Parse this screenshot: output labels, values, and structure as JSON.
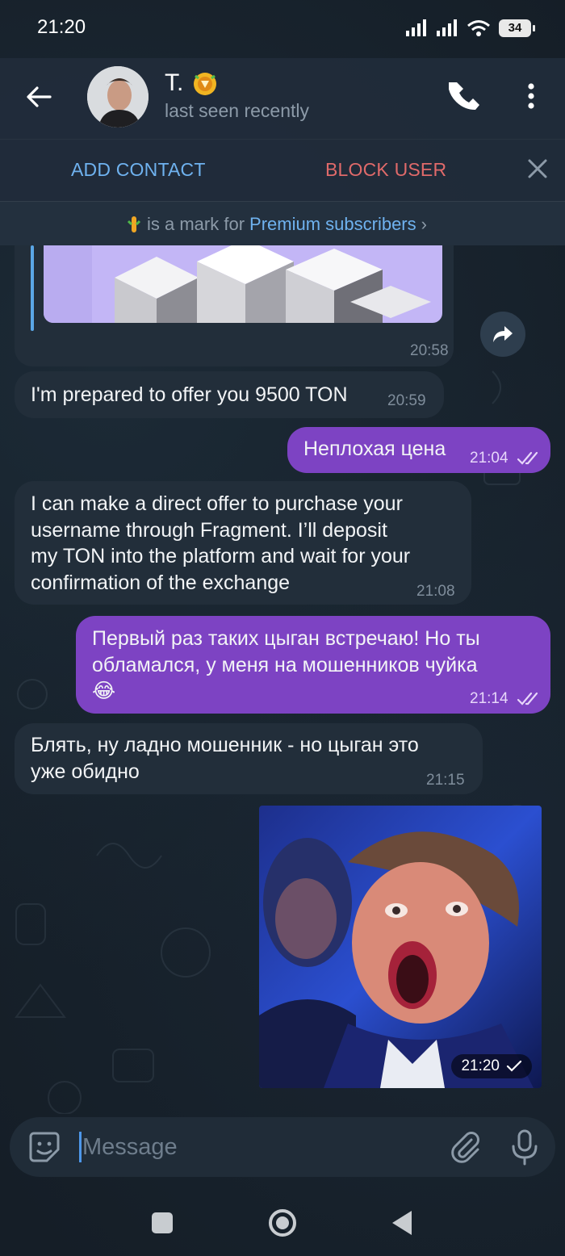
{
  "status_bar": {
    "time": "21:20",
    "battery": "34"
  },
  "header": {
    "contact_name": "T.",
    "status": "last seen recently",
    "add_contact": "ADD CONTACT",
    "block_user": "BLOCK USER",
    "premium_note_prefix": "is a mark for",
    "premium_note_link": "Premium subscribers",
    "premium_note_chevron": "›"
  },
  "messages": [
    {
      "id": "m0",
      "direction": "in",
      "kind": "sticker-card",
      "time": "20:58"
    },
    {
      "id": "m1",
      "direction": "in",
      "text": "I'm prepared to offer you 9500 TON",
      "time": "20:59"
    },
    {
      "id": "m2",
      "direction": "out",
      "text": "Неплохая цена",
      "time": "21:04",
      "read": true
    },
    {
      "id": "m3",
      "direction": "in",
      "lines": [
        "I can make a direct offer to purchase your",
        "username through Fragment. I’ll deposit",
        "my TON into the platform and wait for your",
        "confirmation of the exchange"
      ],
      "time": "21:08"
    },
    {
      "id": "m4",
      "direction": "out",
      "lines": [
        "Первый раз таких цыган встречаю! Но ты",
        "обламался, у меня на мошенников чуйка"
      ],
      "emoji": "😂",
      "time": "21:14",
      "read": true
    },
    {
      "id": "m5",
      "direction": "in",
      "lines": [
        "Блять, ну ладно мошенник - но цыган это",
        "уже обидно"
      ],
      "time": "21:15"
    },
    {
      "id": "m6",
      "direction": "out",
      "kind": "photo",
      "time": "21:20",
      "read": false
    }
  ],
  "composer": {
    "placeholder": "Message"
  },
  "colors": {
    "accent_link": "#6fb2ef",
    "danger": "#e06a6a",
    "outgoing_bubble": "#7d43c3",
    "incoming_bubble": "#222e3a"
  }
}
